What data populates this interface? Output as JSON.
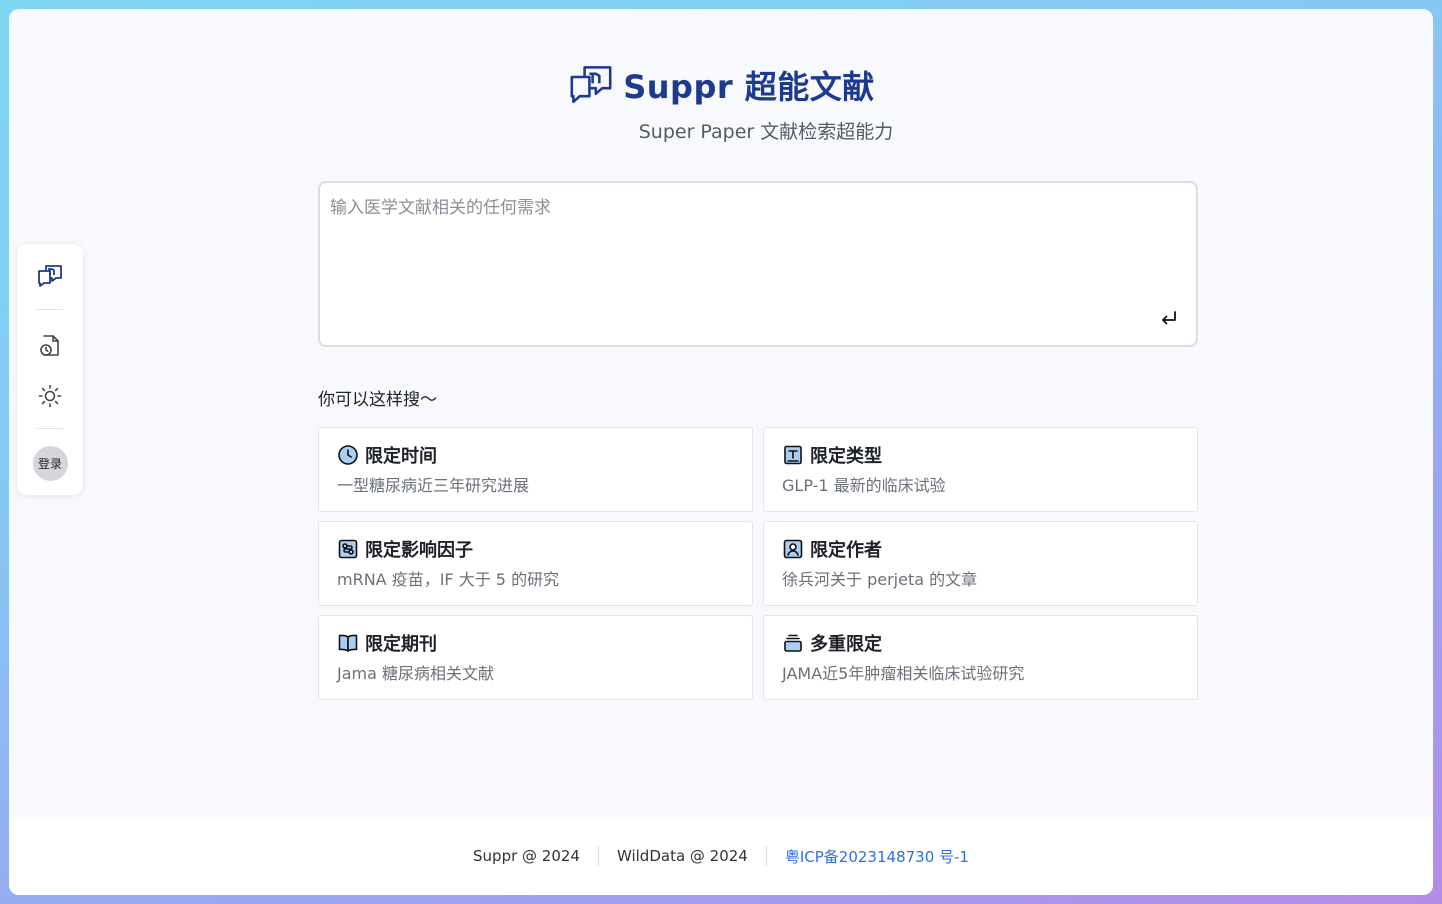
{
  "brand": {
    "name": "Suppr 超能文献",
    "tagline": "Super Paper 文献检索超能力"
  },
  "sidebar": {
    "items": [
      {
        "icon": "chat-logo-icon"
      },
      {
        "icon": "history-document-icon"
      },
      {
        "icon": "sun-icon"
      }
    ],
    "login_label": "登录"
  },
  "search": {
    "placeholder": "输入医学文献相关的任何需求",
    "value": ""
  },
  "hints": {
    "title": "你可以这样搜～",
    "cards": [
      {
        "icon": "clock-icon",
        "title": "限定时间",
        "desc": "一型糖尿病近三年研究进展"
      },
      {
        "icon": "type-icon",
        "title": "限定类型",
        "desc": "GLP-1 最新的临床试验"
      },
      {
        "icon": "impact-factor-icon",
        "title": "限定影响因子",
        "desc": "mRNA 疫苗，IF 大于 5 的研究"
      },
      {
        "icon": "author-icon",
        "title": "限定作者",
        "desc": "徐兵河关于 perjeta 的文章"
      },
      {
        "icon": "book-open-icon",
        "title": "限定期刊",
        "desc": "Jama 糖尿病相关文献"
      },
      {
        "icon": "stack-icon",
        "title": "多重限定",
        "desc": "JAMA近5年肿瘤相关临床试验研究"
      }
    ]
  },
  "footer": {
    "copyright1": "Suppr @ 2024",
    "copyright2": "WildData @ 2024",
    "icp": "粤ICP备2023148730 号-1"
  },
  "colors": {
    "brand": "#1d3a8f",
    "icon_fill": "#a9cdf3",
    "link": "#2f6fe0"
  }
}
